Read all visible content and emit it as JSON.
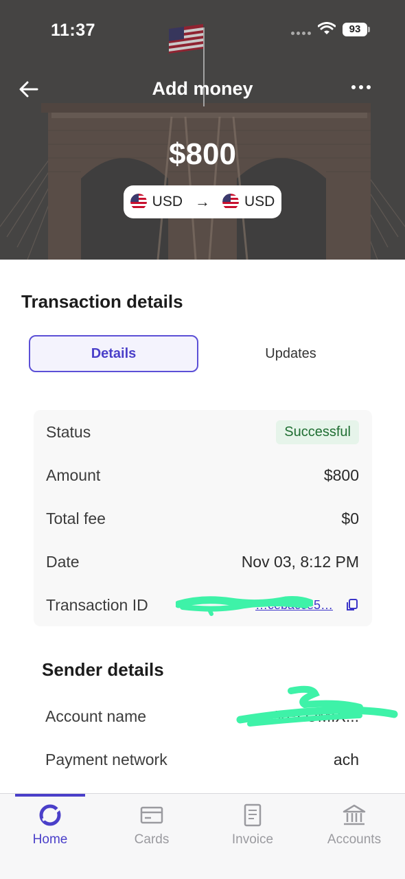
{
  "status_bar": {
    "time": "11:37",
    "battery": "93"
  },
  "header": {
    "title": "Add money",
    "amount": "$800",
    "from_currency": "USD",
    "to_currency": "USD"
  },
  "transaction": {
    "section_title": "Transaction details",
    "tabs": [
      {
        "label": "Details"
      },
      {
        "label": "Updates"
      }
    ],
    "rows": {
      "status": {
        "label": "Status",
        "value": "Successful"
      },
      "amount": {
        "label": "Amount",
        "value": "$800"
      },
      "total_fee": {
        "label": "Total fee",
        "value": "$0"
      },
      "date": {
        "label": "Date",
        "value": "Nov 03, 8:12 PM"
      },
      "transaction_id": {
        "label": "Transaction ID",
        "value": "…cebacce5…"
      }
    }
  },
  "sender": {
    "section_title": "Sender details",
    "rows": {
      "account_name": {
        "label": "Account name",
        "value": "VELOMIX..."
      },
      "payment_network": {
        "label": "Payment network",
        "value": "ach"
      }
    }
  },
  "tabbar": {
    "items": [
      {
        "label": "Home",
        "icon": "home-logo-icon",
        "active": true
      },
      {
        "label": "Cards",
        "icon": "card-icon",
        "active": false
      },
      {
        "label": "Invoice",
        "icon": "document-icon",
        "active": false
      },
      {
        "label": "Accounts",
        "icon": "bank-icon",
        "active": false
      }
    ]
  },
  "colors": {
    "accent": "#4a3fc9",
    "success_bg": "#e6f4ea",
    "success_text": "#1f6e32",
    "redaction": "#3ef2a8"
  }
}
